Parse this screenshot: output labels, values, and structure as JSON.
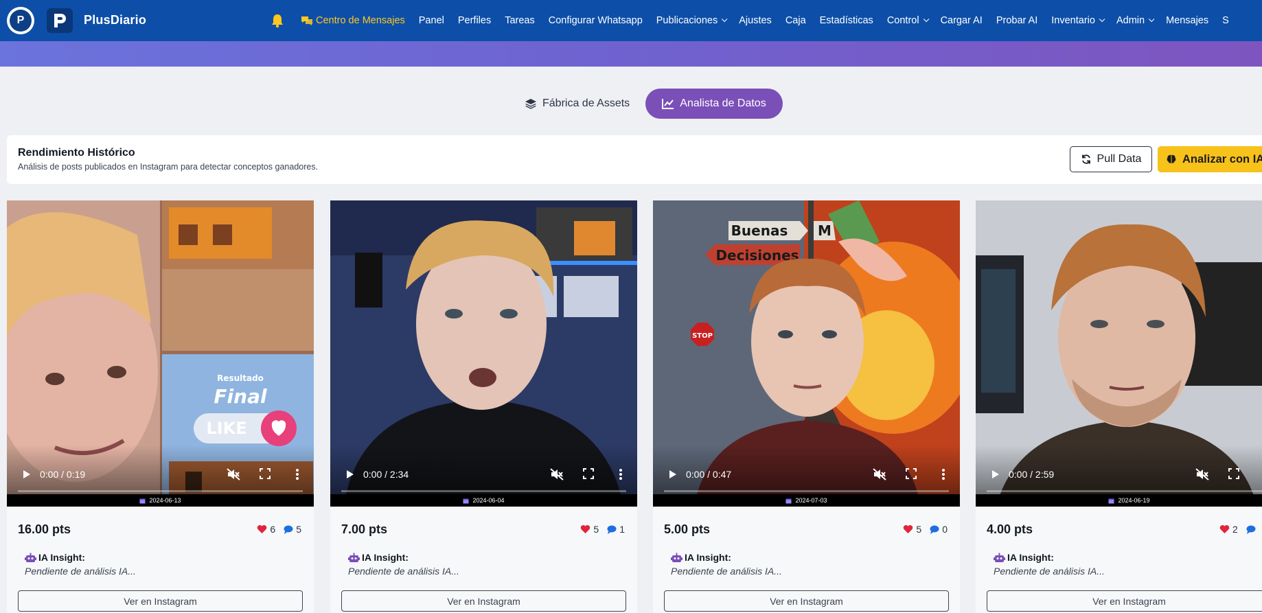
{
  "brand": {
    "name": "PlusDiario",
    "logo_letter": "P"
  },
  "nav": {
    "items": [
      {
        "label": "Centro de Mensajes",
        "active": true,
        "dropdown": false,
        "icon": "chat-icon"
      },
      {
        "label": "Panel",
        "dropdown": false
      },
      {
        "label": "Perfiles",
        "dropdown": false
      },
      {
        "label": "Tareas",
        "dropdown": false
      },
      {
        "label": "Configurar Whatsapp",
        "dropdown": false
      },
      {
        "label": "Publicaciones",
        "dropdown": true
      },
      {
        "label": "Ajustes",
        "dropdown": false
      },
      {
        "label": "Caja",
        "dropdown": false
      },
      {
        "label": "Estadísticas",
        "dropdown": false
      },
      {
        "label": "Control",
        "dropdown": true
      },
      {
        "label": "Cargar AI",
        "dropdown": false
      },
      {
        "label": "Probar AI",
        "dropdown": false
      },
      {
        "label": "Inventario",
        "dropdown": true
      },
      {
        "label": "Admin",
        "dropdown": true
      },
      {
        "label": "Mensajes",
        "dropdown": false
      },
      {
        "label": "S",
        "dropdown": false
      }
    ]
  },
  "tabs": {
    "fabrica": "Fábrica de Assets",
    "analista": "Analista de Datos"
  },
  "section": {
    "title": "Rendimiento Histórico",
    "subtitle": "Análisis de posts publicados en Instagram para detectar conceptos ganadores.",
    "pull_label": "Pull Data",
    "analyze_label": "Analizar con IA"
  },
  "cards": [
    {
      "time": "0:00 / 0:19",
      "date": "2024-06-13",
      "points": "16.00 pts",
      "likes": "6",
      "comments": "5",
      "ia_label": "IA Insight:",
      "ia_text": "Pendiente de análisis IA...",
      "button": "Ver en Instagram"
    },
    {
      "time": "0:00 / 2:34",
      "date": "2024-06-04",
      "points": "7.00 pts",
      "likes": "5",
      "comments": "1",
      "ia_label": "IA Insight:",
      "ia_text": "Pendiente de análisis IA...",
      "button": "Ver en Instagram"
    },
    {
      "time": "0:00 / 0:47",
      "date": "2024-07-03",
      "points": "5.00 pts",
      "likes": "5",
      "comments": "0",
      "ia_label": "IA Insight:",
      "ia_text": "Pendiente de análisis IA...",
      "button": "Ver en Instagram"
    },
    {
      "time": "0:00 / 2:59",
      "date": "2024-06-19",
      "points": "4.00 pts",
      "likes": "2",
      "comments": "",
      "ia_label": "IA Insight:",
      "ia_text": "Pendiente de análisis IA...",
      "button": "Ver en Instagram"
    }
  ],
  "thumb_text": {
    "card1_title1": "Resultado",
    "card1_title2": "Final",
    "card1_like": "LIKE",
    "card3_sign1": "Buenas",
    "card3_sign2": "Decisiones",
    "card3_sign3": "M",
    "card3_stop": "STOP"
  },
  "colors": {
    "navbar": "#0d4fa8",
    "active_nav": "#ffc81f",
    "tab_active": "#7b4fb8",
    "analyze_button": "#f7c21a",
    "heart": "#e0243d",
    "comment": "#1d6fe0",
    "robot": "#7b4fb8"
  }
}
